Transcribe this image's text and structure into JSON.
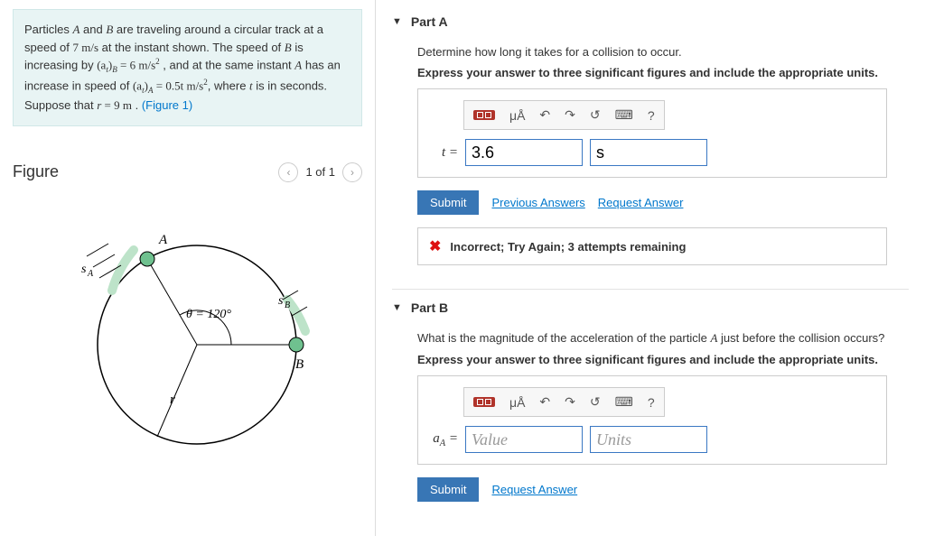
{
  "problem": {
    "text_parts": {
      "p1": "Particles ",
      "a": "A",
      "p2": " and ",
      "b": "B",
      "p3": " are traveling around a circular track at a speed of ",
      "speed": "7  m/s",
      "p4": " at the instant shown. The speed of ",
      "p5": " is increasing by ",
      "atB": "(a",
      "atB_sub": "t",
      "atB2": ")",
      "atB_sub2": "B",
      "eq1": " = 6  m/s",
      "sq": "2",
      "p6": " , and at the same instant ",
      "p7": " has an increase in speed of ",
      "atA": "(a",
      "atA_sub": "t",
      "atA2": ")",
      "atA_sub2": "A",
      "eq2": " = 0.5t  m/s",
      "p8": ", where ",
      "tvar": "t",
      "p9": " is in seconds. Suppose that ",
      "rvar": "r",
      "eq3": " = 9  m",
      "p10": " . ",
      "figlink": "(Figure 1)"
    }
  },
  "figure": {
    "title": "Figure",
    "pager": "1 of 1",
    "labels": {
      "A": "A",
      "B": "B",
      "sA": "s",
      "sA_sub": "A",
      "sB": "s",
      "sB_sub": "B",
      "theta": "θ = 120°",
      "r": "r"
    }
  },
  "partA": {
    "title": "Part A",
    "prompt": "Determine how long it takes for a collision to occur.",
    "instruction": "Express your answer to three significant figures and include the appropriate units.",
    "var": "t = ",
    "value": "3.6",
    "unit": "s",
    "submit": "Submit",
    "prev": "Previous Answers",
    "req": "Request Answer",
    "feedback": "Incorrect; Try Again; 3 attempts remaining"
  },
  "partB": {
    "title": "Part B",
    "prompt_pre": "What is the magnitude of the acceleration of the particle ",
    "prompt_var": "A",
    "prompt_post": " just before the collision occurs?",
    "instruction": "Express your answer to three significant figures and include the appropriate units.",
    "var_pre": "a",
    "var_sub": "A",
    "var_post": " = ",
    "value_ph": "Value",
    "unit_ph": "Units",
    "submit": "Submit",
    "req": "Request Answer"
  },
  "toolbar": {
    "mu": "μÅ",
    "undo": "↶",
    "redo": "↷",
    "reset": "↺",
    "kbd": "⌨",
    "help": "?"
  }
}
